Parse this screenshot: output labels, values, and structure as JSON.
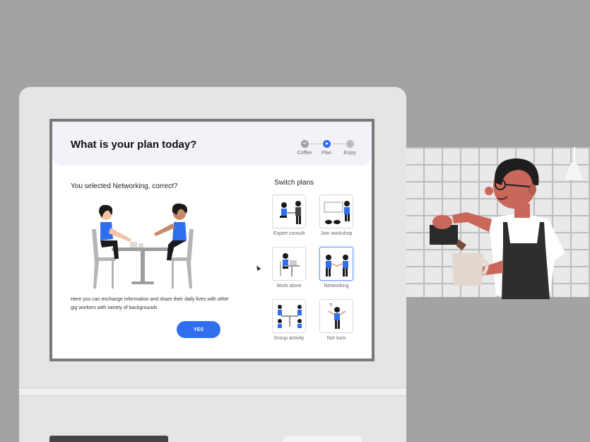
{
  "screen": {
    "title": "What is your plan today?",
    "steps": [
      {
        "label": "Coffee",
        "state": "done",
        "icon": "check-icon"
      },
      {
        "label": "Plan",
        "state": "current",
        "icon": "play-icon"
      },
      {
        "label": "Enjoy",
        "state": "upcoming",
        "icon": "dot-icon"
      }
    ],
    "question": "You selected Networking, correct?",
    "description": "Here you can exchange information and share  their daily lives with other gig workers with variety of  backgrounds",
    "yes_label": "YES",
    "switch_title": "Switch plans",
    "plans": [
      {
        "label": "Expert consult",
        "selected": false
      },
      {
        "label": "Join workshop",
        "selected": false
      },
      {
        "label": "Work alone",
        "selected": false
      },
      {
        "label": "Networking",
        "selected": true
      },
      {
        "label": "Group activity",
        "selected": false
      },
      {
        "label": "Not sure",
        "selected": false
      }
    ]
  },
  "colors": {
    "accent": "#2f6fef",
    "header_bg": "#f2f2f8",
    "background": "#a3a3a3",
    "kiosk": "#e5e5e5",
    "skin": "#c9675a",
    "apron": "#2e2e2e"
  }
}
